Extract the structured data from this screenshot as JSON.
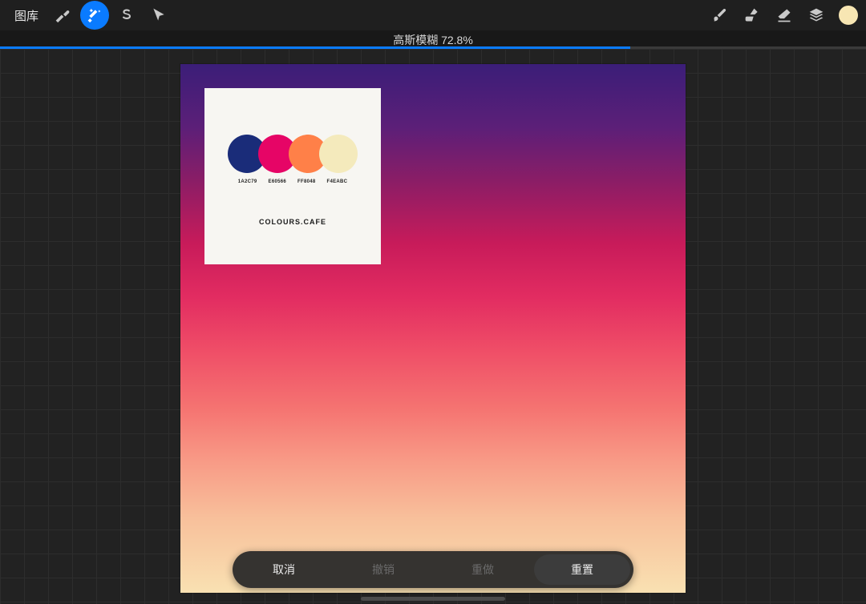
{
  "topbar": {
    "gallery_label": "图库",
    "icons": {
      "wrench": "wrench-icon",
      "wand": "magic-wand-icon",
      "selection": "selection-s-icon",
      "cursor": "pointer-arrow-icon",
      "brush": "brush-icon",
      "smudge": "smudge-icon",
      "eraser": "eraser-icon",
      "layers": "layers-icon"
    },
    "current_color": "#f7e6b3"
  },
  "filter": {
    "name": "高斯模糊",
    "percent_label": "72.8%",
    "percent_value": 72.8
  },
  "palette_card": {
    "brand": "COLOURS.CAFE",
    "swatches": [
      {
        "hex": "1A2C79",
        "color": "#1a2c79"
      },
      {
        "hex": "E60566",
        "color": "#e60566"
      },
      {
        "hex": "FF8048",
        "color": "#ff8048"
      },
      {
        "hex": "F4EABC",
        "color": "#f4eabc"
      }
    ]
  },
  "actions": {
    "cancel": "取消",
    "undo": "撤销",
    "redo": "重做",
    "reset": "重置"
  }
}
